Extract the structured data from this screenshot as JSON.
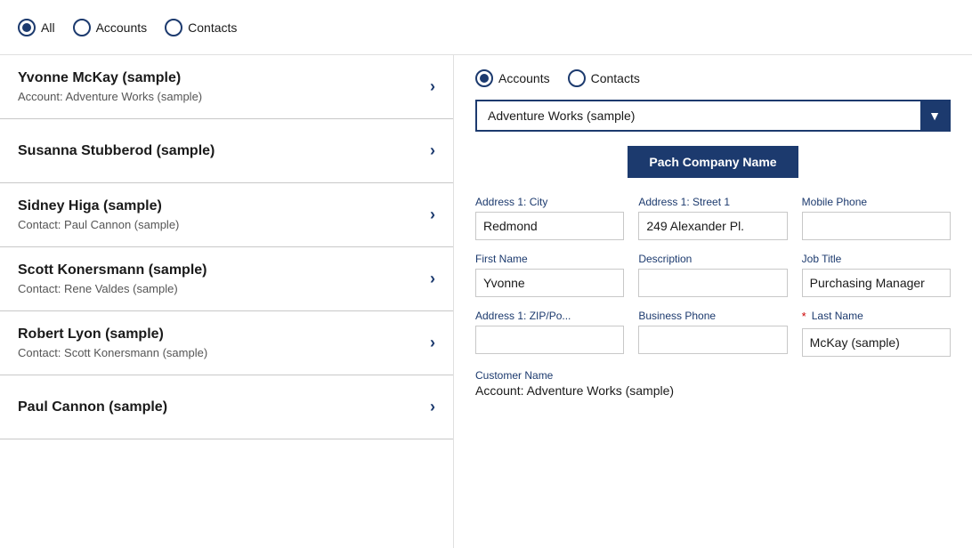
{
  "topBar": {
    "options": [
      {
        "id": "all",
        "label": "All",
        "selected": true
      },
      {
        "id": "accounts",
        "label": "Accounts",
        "selected": false
      },
      {
        "id": "contacts",
        "label": "Contacts",
        "selected": false
      }
    ]
  },
  "listItems": [
    {
      "name": "Yvonne McKay (sample)",
      "sub": "Account: Adventure Works (sample)"
    },
    {
      "name": "Susanna Stubberod (sample)",
      "sub": ""
    },
    {
      "name": "Sidney Higa (sample)",
      "sub": "Contact: Paul Cannon (sample)"
    },
    {
      "name": "Scott Konersmann (sample)",
      "sub": "Contact: Rene Valdes (sample)"
    },
    {
      "name": "Robert Lyon (sample)",
      "sub": "Contact: Scott Konersmann (sample)"
    },
    {
      "name": "Paul Cannon (sample)",
      "sub": ""
    }
  ],
  "rightPanel": {
    "radioOptions": [
      {
        "id": "accounts",
        "label": "Accounts",
        "selected": true
      },
      {
        "id": "contacts",
        "label": "Contacts",
        "selected": false
      }
    ],
    "dropdown": {
      "value": "Adventure Works (sample)",
      "arrowLabel": "▼"
    },
    "actionButton": "Pach Company Name",
    "fields": [
      {
        "label": "Address 1: City",
        "value": "Redmond",
        "required": false,
        "id": "address1-city"
      },
      {
        "label": "Address 1: Street 1",
        "value": "249 Alexander Pl.",
        "required": false,
        "id": "address1-street1"
      },
      {
        "label": "Mobile Phone",
        "value": "",
        "required": false,
        "id": "mobile-phone"
      },
      {
        "label": "First Name",
        "value": "Yvonne",
        "required": false,
        "id": "first-name"
      },
      {
        "label": "Description",
        "value": "",
        "required": false,
        "id": "description"
      },
      {
        "label": "Job Title",
        "value": "Purchasing Manager",
        "required": false,
        "id": "job-title"
      },
      {
        "label": "Address 1: ZIP/Po...",
        "value": "",
        "required": false,
        "id": "address1-zip"
      },
      {
        "label": "Business Phone",
        "value": "",
        "required": false,
        "id": "business-phone"
      },
      {
        "label": "Last Name",
        "value": "McKay (sample)",
        "required": true,
        "id": "last-name"
      }
    ],
    "customerName": {
      "label": "Customer Name",
      "value": "Account: Adventure Works (sample)"
    }
  }
}
